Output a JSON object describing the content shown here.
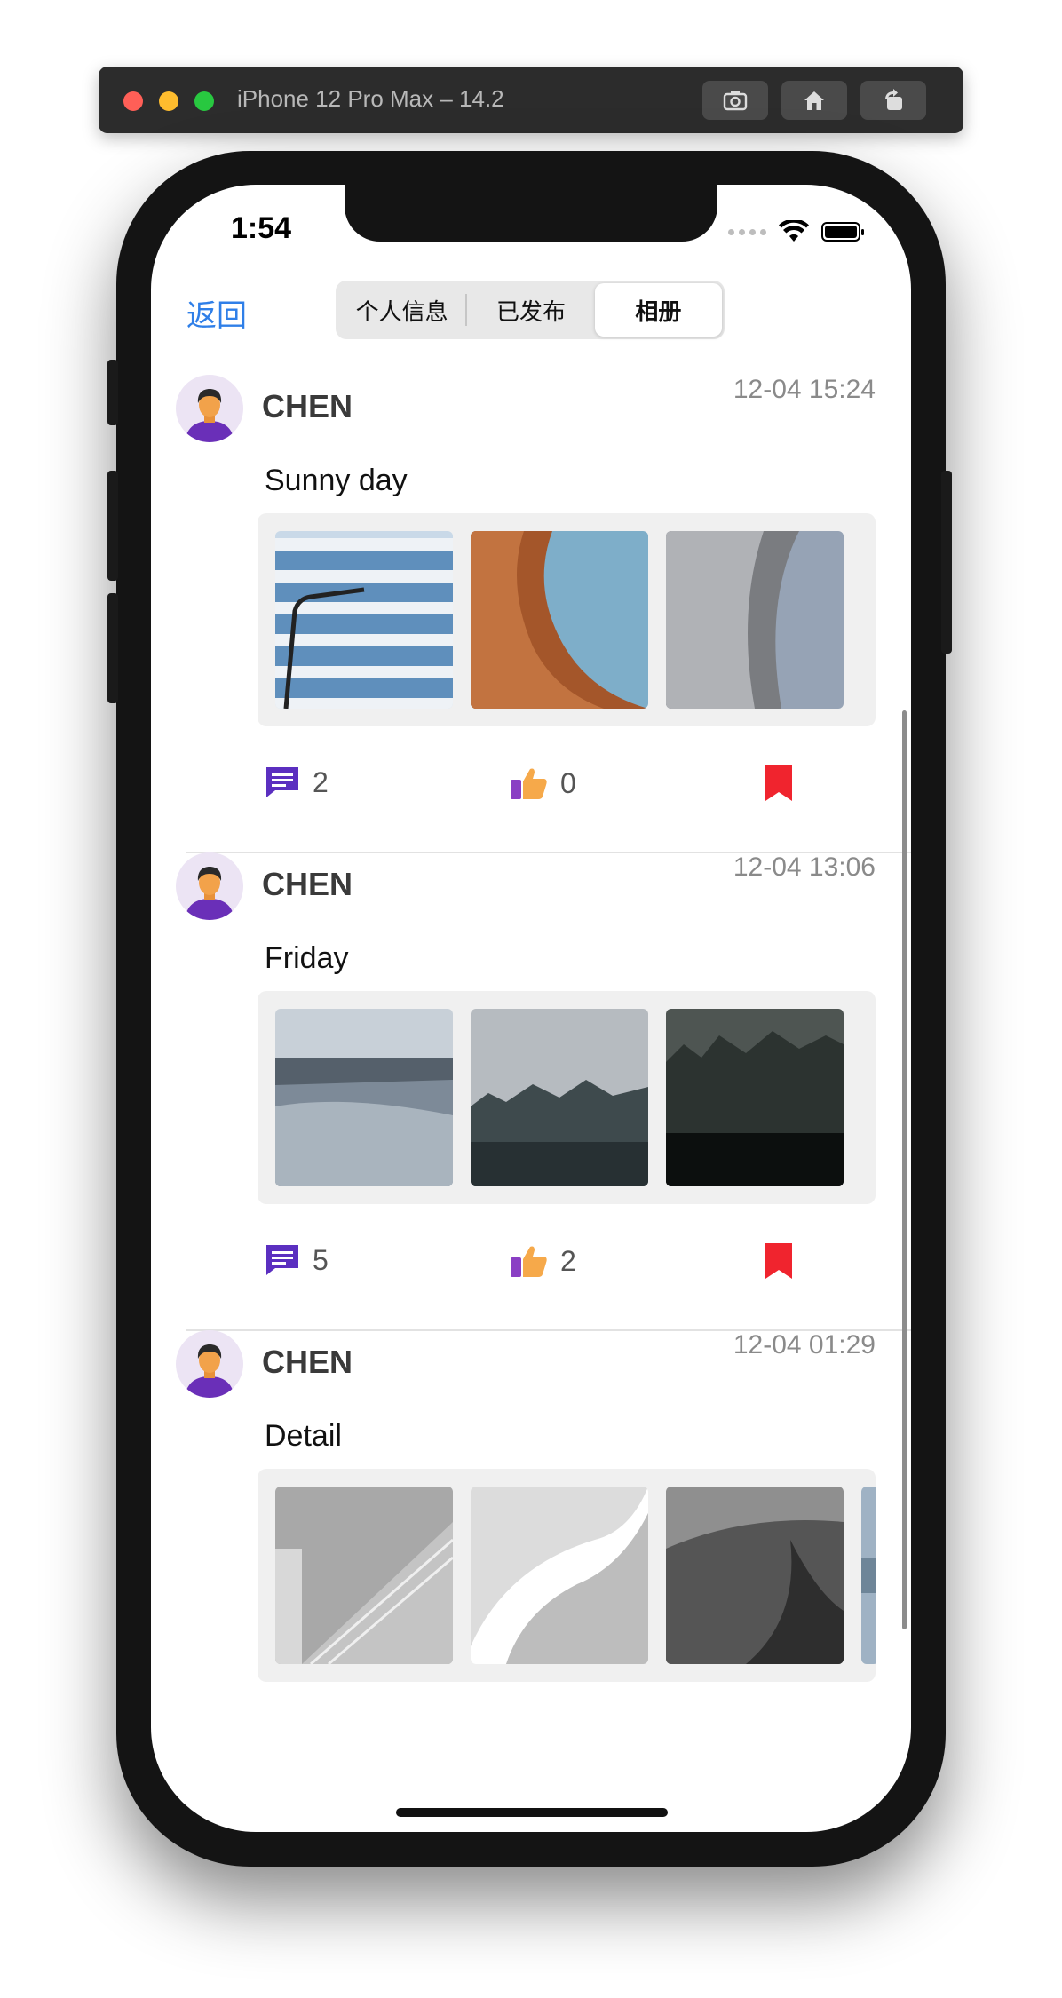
{
  "simulator": {
    "title": "iPhone 12 Pro Max – 14.2",
    "buttons": [
      "screenshot-icon",
      "home-icon",
      "rotate-icon"
    ]
  },
  "status_bar": {
    "time": "1:54"
  },
  "nav": {
    "back_label": "返回",
    "segments": [
      "个人信息",
      "已发布",
      "相册"
    ],
    "selected_segment": "相册"
  },
  "posts": [
    {
      "username": "CHEN",
      "timestamp": "12-04 15:24",
      "text": "Sunny day",
      "comments": "2",
      "likes": "0"
    },
    {
      "username": "CHEN",
      "timestamp": "12-04 13:06",
      "text": "Friday",
      "comments": "5",
      "likes": "2"
    },
    {
      "username": "CHEN",
      "timestamp": "12-04 01:29",
      "text": "Detail"
    }
  ],
  "colors": {
    "accent": "#2f7fe8",
    "comment_icon": "#5b2fc0",
    "bookmark_icon": "#f0242e",
    "like_icon": "#f6a94a"
  }
}
